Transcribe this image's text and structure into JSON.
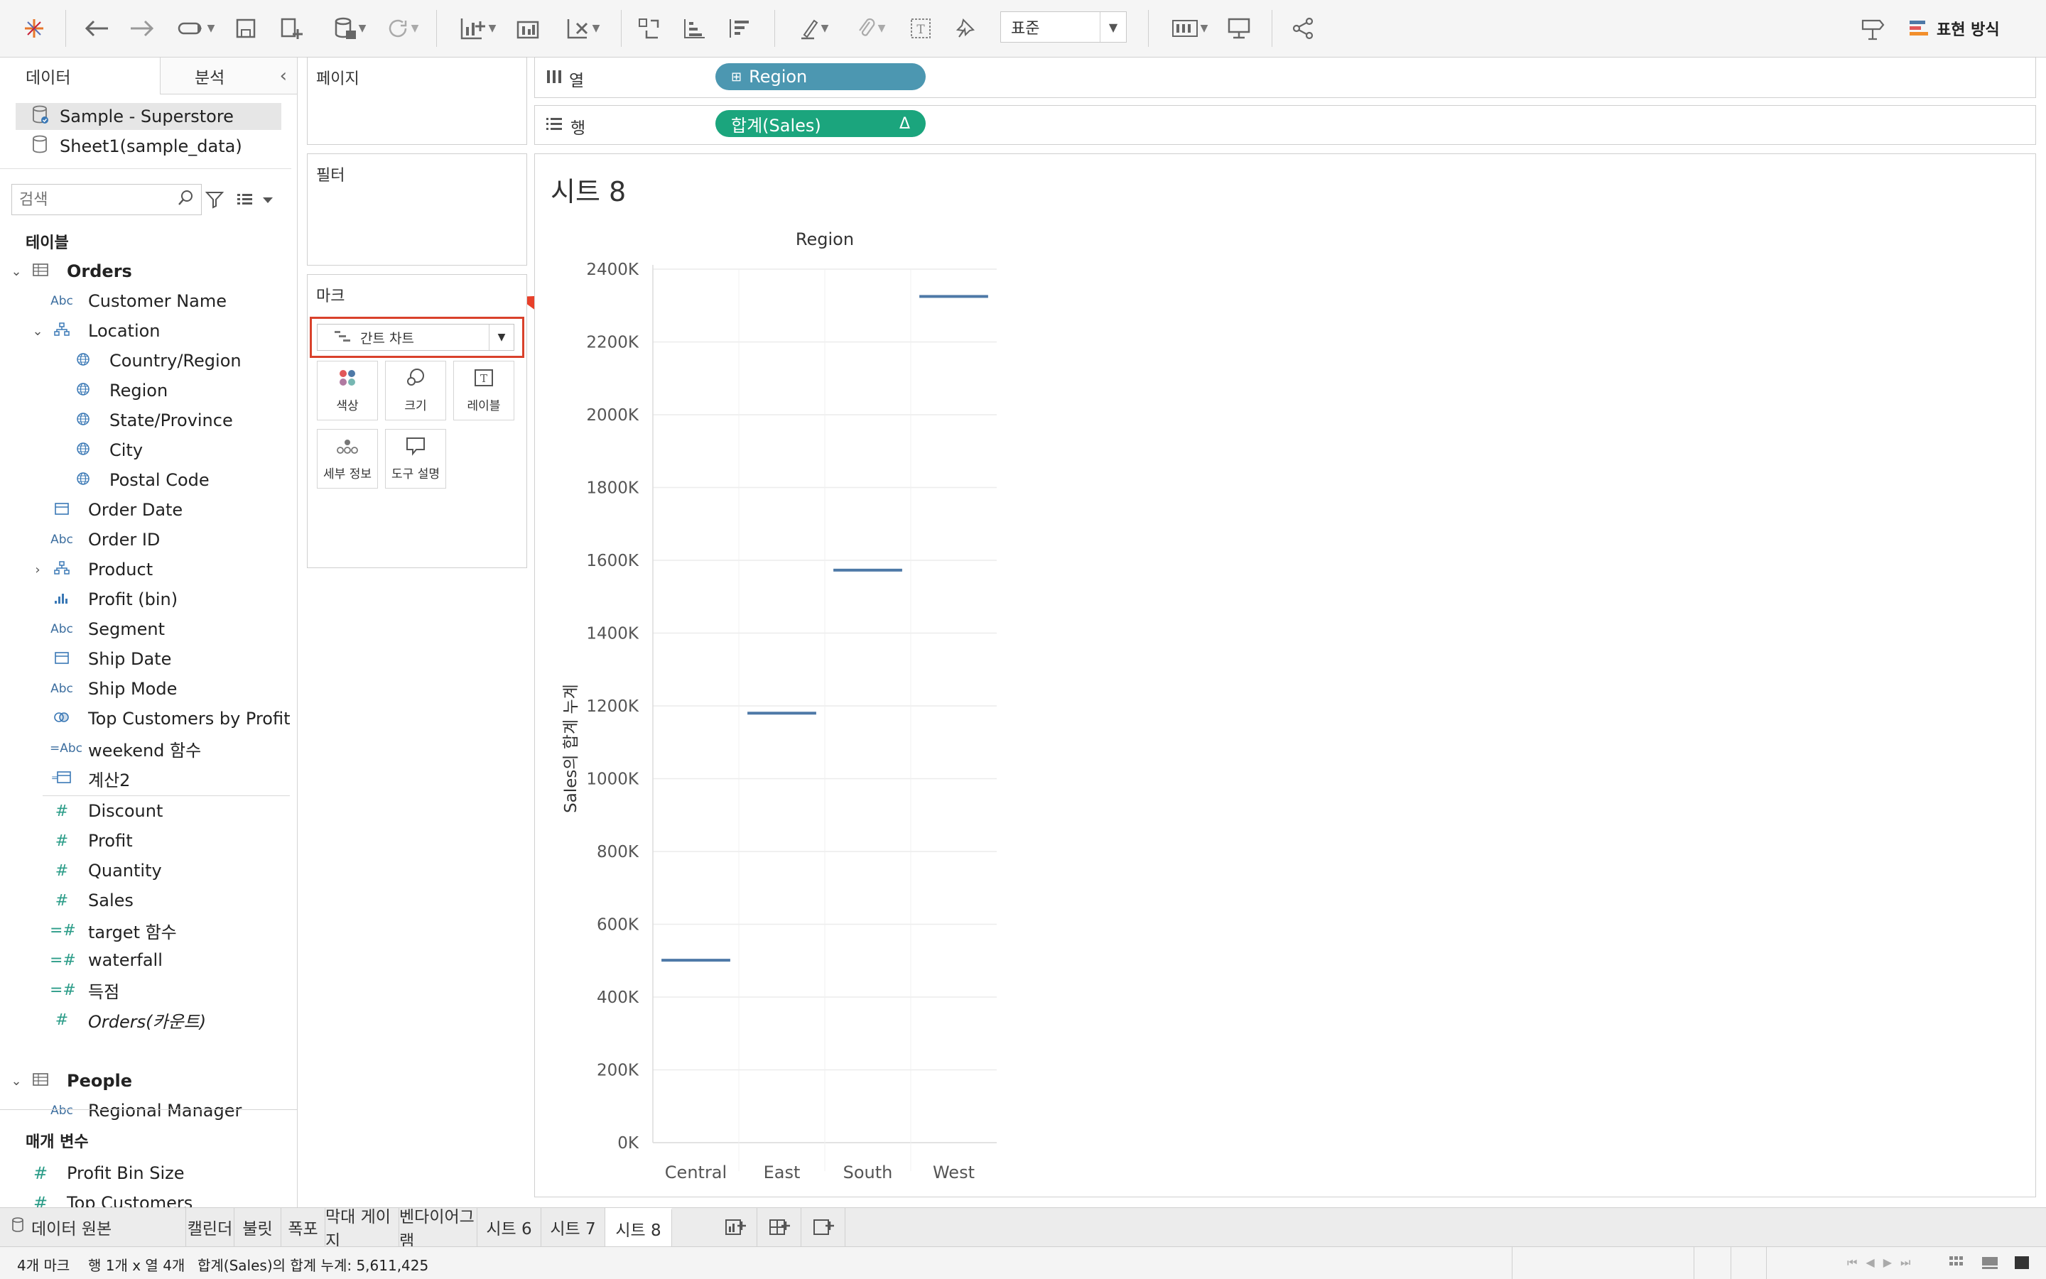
{
  "toolbar": {
    "format_select": "표준",
    "show_me_label": "표현 방식"
  },
  "left_panel": {
    "tabs": {
      "data": "데이터",
      "analysis": "분석"
    },
    "datasources": [
      "Sample - Superstore",
      "Sheet1(sample_data)"
    ],
    "search_placeholder": "검색",
    "tables_header": "테이블",
    "orders_table": "Orders",
    "fields": [
      {
        "label": "Customer Name",
        "type": "Abc"
      },
      {
        "label": "Location",
        "type": "hierarchy"
      },
      {
        "label": "Country/Region",
        "type": "geo"
      },
      {
        "label": "Region",
        "type": "geo"
      },
      {
        "label": "State/Province",
        "type": "geo"
      },
      {
        "label": "City",
        "type": "geo"
      },
      {
        "label": "Postal Code",
        "type": "geo"
      },
      {
        "label": "Order Date",
        "type": "date"
      },
      {
        "label": "Order ID",
        "type": "Abc"
      },
      {
        "label": "Product",
        "type": "hierarchy"
      },
      {
        "label": "Profit (bin)",
        "type": "bin"
      },
      {
        "label": "Segment",
        "type": "Abc"
      },
      {
        "label": "Ship Date",
        "type": "date"
      },
      {
        "label": "Ship Mode",
        "type": "Abc"
      },
      {
        "label": "Top Customers by Profit",
        "type": "set"
      },
      {
        "label": "weekend 함수",
        "type": "=Abc"
      },
      {
        "label": "계산2",
        "type": "=date"
      }
    ],
    "measures": [
      {
        "label": "Discount",
        "type": "#"
      },
      {
        "label": "Profit",
        "type": "#"
      },
      {
        "label": "Quantity",
        "type": "#"
      },
      {
        "label": "Sales",
        "type": "#"
      },
      {
        "label": "target 함수",
        "type": "=#"
      },
      {
        "label": "waterfall",
        "type": "=#"
      },
      {
        "label": "득점",
        "type": "=#"
      },
      {
        "label": "Orders(카운트)",
        "type": "#"
      }
    ],
    "people_table": "People",
    "people_fields": [
      {
        "label": "Regional Manager",
        "type": "Abc"
      }
    ],
    "params_header": "매개 변수",
    "params": [
      {
        "label": "Profit Bin Size"
      },
      {
        "label": "Top Customers"
      }
    ]
  },
  "shelves": {
    "pages": "페이지",
    "filters": "필터",
    "marks": "마크",
    "mark_type": "간트 차트",
    "mark_buttons": {
      "color": "색상",
      "size": "크기",
      "label": "레이블",
      "detail": "세부 정보",
      "tooltip": "도구 설명"
    },
    "columns_label": "열",
    "rows_label": "행",
    "columns_pill": "Region",
    "rows_pill": "합계(Sales)",
    "rows_pill_flag": "Δ"
  },
  "view": {
    "sheet_title": "시트 8"
  },
  "chart_data": {
    "type": "gantt",
    "title": "",
    "column_header": "Region",
    "ylabel": "Sales의 합계 누계",
    "categories": [
      "Central",
      "East",
      "South",
      "West"
    ],
    "values": [
      501240,
      1180000,
      1573000,
      2325000
    ],
    "ylim": [
      0,
      2400000
    ],
    "yticks": [
      0,
      200000,
      400000,
      600000,
      800000,
      1000000,
      1200000,
      1400000,
      1600000,
      1800000,
      2000000,
      2200000,
      2400000
    ],
    "ytick_labels": [
      "0K",
      "200K",
      "400K",
      "600K",
      "800K",
      "1000K",
      "1200K",
      "1400K",
      "1600K",
      "1800K",
      "2000K",
      "2200K",
      "2400K"
    ],
    "grid": true,
    "mark_color": "#4e79a7"
  },
  "sheet_tabs": {
    "datasource": "데이터 원본",
    "sheets": [
      "캘린더",
      "불릿",
      "폭포",
      "막대 게이지",
      "벤다이어그램",
      "시트 6",
      "시트 7",
      "시트 8"
    ],
    "active": "시트 8"
  },
  "status": {
    "marks": "4개 마크",
    "rows_cols": "행 1개 x 열 4개",
    "sum": "합계(Sales)의 합계 누계: 5,611,425"
  },
  "colors": {
    "region_pill": "#4c97b1",
    "sales_pill": "#1ba57d",
    "highlight_box": "#d9412b",
    "star": "#e8402a"
  }
}
